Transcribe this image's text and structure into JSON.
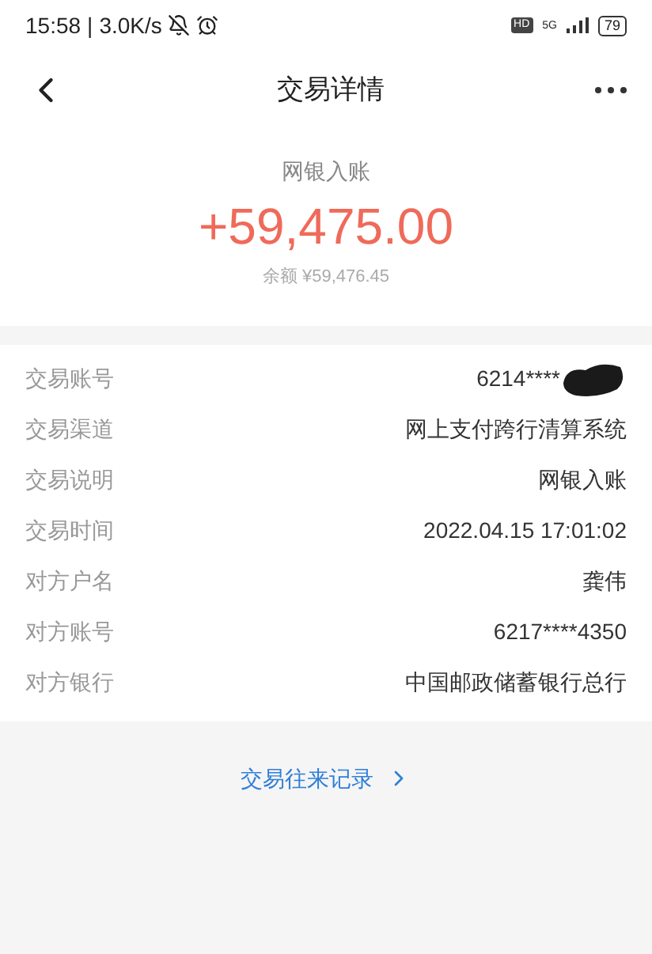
{
  "status_bar": {
    "time": "15:58",
    "separator": "|",
    "speed": "3.0K/s",
    "hd": "HD",
    "network": "5G",
    "battery": "79"
  },
  "header": {
    "title": "交易详情"
  },
  "summary": {
    "type": "网银入账",
    "amount": "+59,475.00",
    "balance": "余额 ¥59,476.45"
  },
  "details": [
    {
      "label": "交易账号",
      "value": "6214****",
      "redacted": true
    },
    {
      "label": "交易渠道",
      "value": "网上支付跨行清算系统",
      "redacted": false
    },
    {
      "label": "交易说明",
      "value": "网银入账",
      "redacted": false
    },
    {
      "label": "交易时间",
      "value": "2022.04.15 17:01:02",
      "redacted": false
    },
    {
      "label": "对方户名",
      "value": "龚伟",
      "redacted": false
    },
    {
      "label": "对方账号",
      "value": "6217****4350",
      "redacted": false
    },
    {
      "label": "对方银行",
      "value": "中国邮政储蓄银行总行",
      "redacted": false
    }
  ],
  "link": {
    "label": "交易往来记录"
  }
}
